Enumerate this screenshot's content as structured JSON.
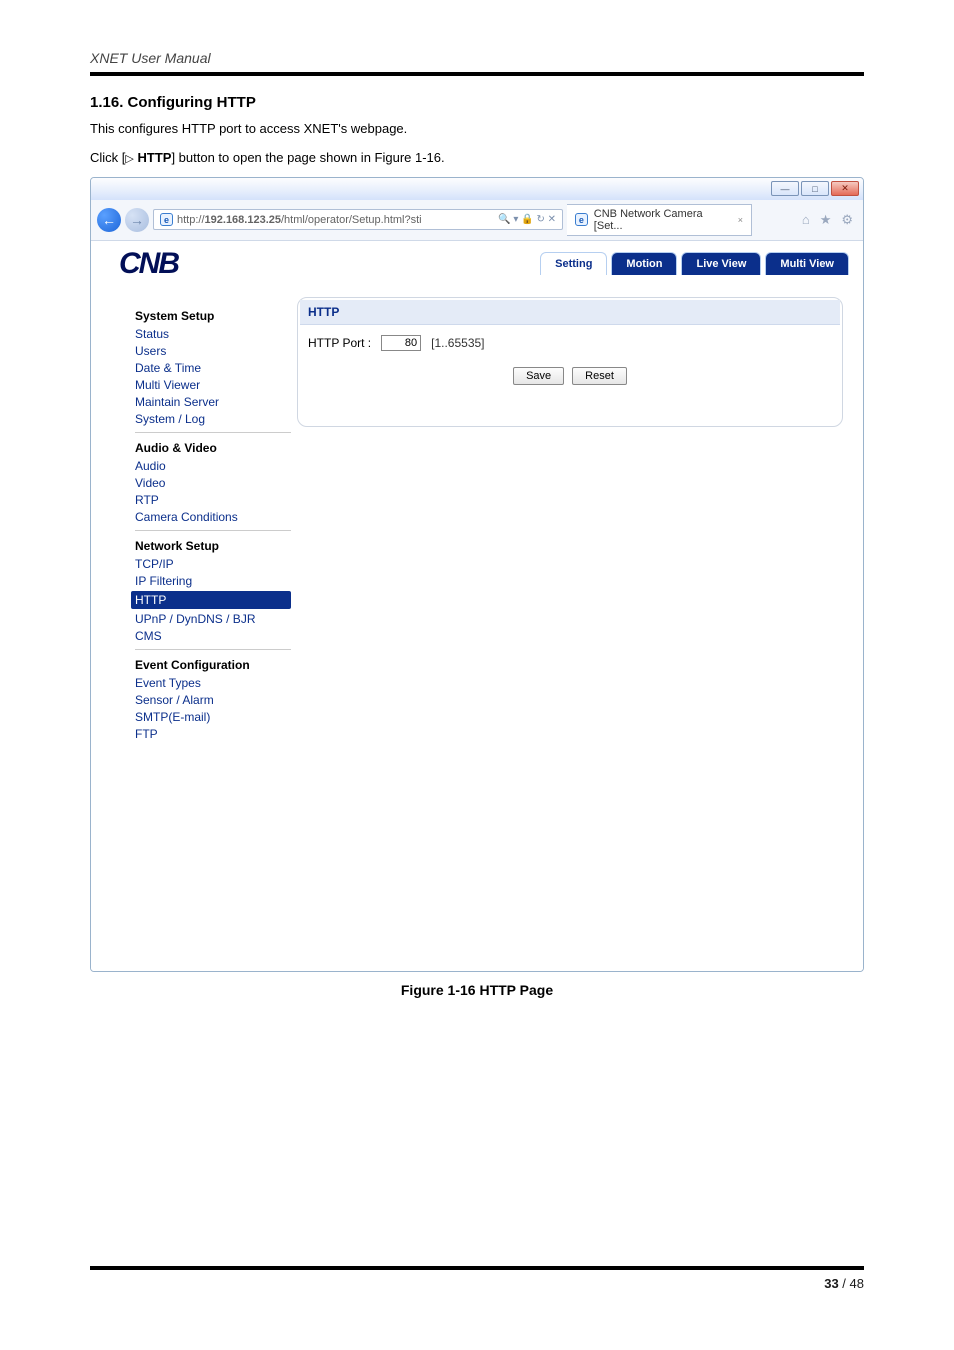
{
  "doc": {
    "header_title": "XNET User Manual",
    "section_number_title": "1.16. Configuring HTTP",
    "intro_line": "This configures HTTP port to access XNET's webpage.",
    "click_prefix": "Click [",
    "click_button_label": "HTTP",
    "click_suffix": "] button to open the page shown in Figure 1-16.",
    "figure_caption": "Figure 1-16 HTTP Page",
    "page_current": "33",
    "page_sep": " / ",
    "page_total": "48"
  },
  "browser": {
    "min_label": "—",
    "max_label": "□",
    "close_label": "✕",
    "url_bolded_host": "192.168.123.25",
    "url_prefix": "http://",
    "url_path": "/html/operator/Setup.html?sti",
    "url_tail_icons": "🔍 ▾  🔒 ↻ ✕",
    "tab_title": "CNB Network Camera [Set...",
    "tab_close": "×",
    "toolbar_home": "⌂",
    "toolbar_star": "★",
    "toolbar_gear": "⚙"
  },
  "app": {
    "tabs": {
      "setting": "Setting",
      "motion": "Motion",
      "live_view": "Live View",
      "multi_view": "Multi View"
    },
    "nav": {
      "group1": "System Setup",
      "g1_items": [
        "Status",
        "Users",
        "Date & Time",
        "Multi Viewer",
        "Maintain Server",
        "System / Log"
      ],
      "group2": "Audio & Video",
      "g2_items": [
        "Audio",
        "Video",
        "RTP",
        "Camera Conditions"
      ],
      "group3": "Network Setup",
      "g3_items": [
        "TCP/IP",
        "IP Filtering",
        "HTTP",
        "UPnP / DynDNS / BJR",
        "CMS"
      ],
      "group4": "Event Configuration",
      "g4_items": [
        "Event Types",
        "Sensor / Alarm",
        "SMTP(E-mail)",
        "FTP"
      ]
    },
    "panel": {
      "title": "HTTP",
      "port_label": "HTTP Port :",
      "port_value": "80",
      "port_range": "[1..65535]",
      "save": "Save",
      "reset": "Reset"
    }
  }
}
